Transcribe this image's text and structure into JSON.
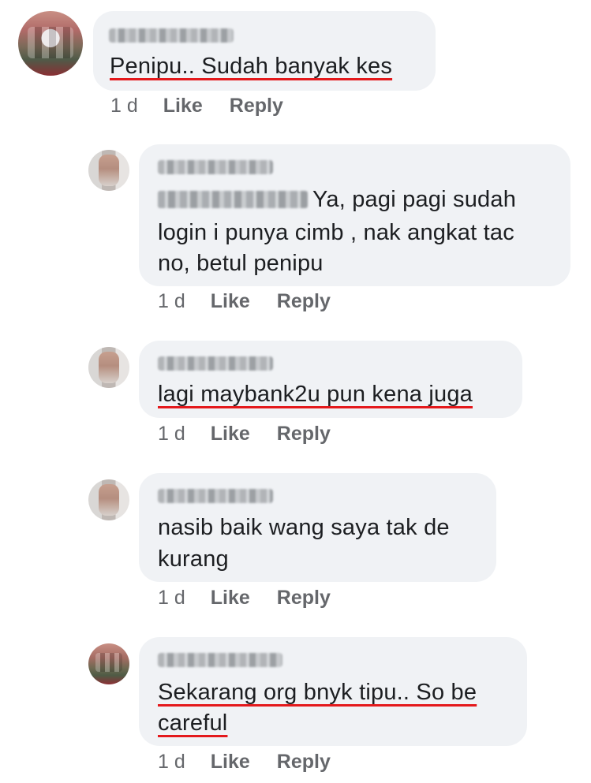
{
  "comments": [
    {
      "author": "Eyra Shahira",
      "text": "Penipu.. Sudah banyak kes",
      "time": "1 d",
      "like": "Like",
      "reply": "Reply"
    },
    {
      "author": "Khoon Gee",
      "mention": "Eyra Shahira",
      "text_line1": "Ya,   pagi pagi sudah",
      "text_line2": "login i punya cimb , nak angkat tac",
      "text_line3": "no, betul penipu",
      "time": "1 d",
      "like": "Like",
      "reply": "Reply"
    },
    {
      "author": "Khoon Gee",
      "text": "lagi maybank2u pun kena juga",
      "time": "1 d",
      "like": "Like",
      "reply": "Reply"
    },
    {
      "author": "Khoon Gee",
      "text_line1": "nasib baik wang saya tak de",
      "text_line2": "kurang",
      "time": "1 d",
      "like": "Like",
      "reply": "Reply"
    },
    {
      "author": "Eyra Shahira",
      "text_line1": "Sekarang org bnyk tipu.. So be",
      "text_line2": "careful",
      "time": "1 d",
      "like": "Like",
      "reply": "Reply"
    }
  ]
}
